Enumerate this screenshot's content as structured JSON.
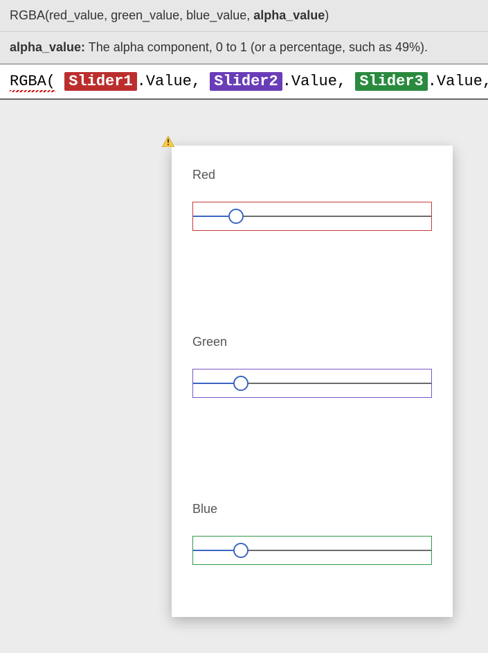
{
  "signatureHelp": {
    "signature_prefix": "RGBA(red_value, green_value, blue_value, ",
    "signature_active_param": "alpha_value",
    "signature_suffix": ")",
    "param_name": "alpha_value:",
    "param_desc": " The alpha component, 0 to 1 (or a percentage, such as 49%)."
  },
  "formula": {
    "func_open": "RGBA(",
    "space": " ",
    "ref1": "Slider1",
    "ref2": "Slider2",
    "ref3": "Slider3",
    "dot_value_comma": ".Value,",
    "dot_value_comma_last": ".Value,",
    "refColors": {
      "slider1": "#bc2e2e",
      "slider2": "#6a3db8",
      "slider3": "#2a8a3e"
    }
  },
  "warningIcon": "warning",
  "card": {
    "sliders": [
      {
        "label": "Red",
        "borderColor": "#c43a3a",
        "percent": 18
      },
      {
        "label": "Green",
        "borderColor": "#7a56c9",
        "percent": 20
      },
      {
        "label": "Blue",
        "borderColor": "#2f9a4a",
        "percent": 20
      }
    ]
  }
}
